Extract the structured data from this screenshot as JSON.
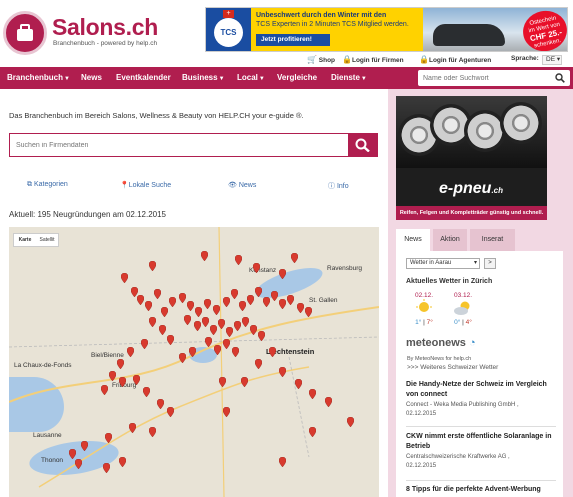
{
  "header": {
    "logo_title": "Salons.ch",
    "logo_subtitle": "Branchenbuch - powered by help.ch",
    "ad": {
      "line1": "Unbeschwert durch den Winter mit den",
      "line2": "TCS Experten in 2 Minuten TCS Mitglied werden.",
      "button": "Jetzt profitieren!",
      "logo": "TCS",
      "badge_l1": "Ostechein",
      "badge_l2": "im Wert von",
      "badge_l3": "CHF 25.-",
      "badge_l4": "schenken."
    },
    "top_links": {
      "shop": "Shop",
      "login_firms": "Login für Firmen",
      "login_agents": "Login für Agenturen",
      "language_label": "Sprache:",
      "language_value": "DE"
    }
  },
  "nav": {
    "items": [
      {
        "label": "Branchenbuch",
        "dropdown": true
      },
      {
        "label": "News",
        "dropdown": false
      },
      {
        "label": "Eventkalender",
        "dropdown": false
      },
      {
        "label": "Business",
        "dropdown": true
      },
      {
        "label": "Local",
        "dropdown": true
      },
      {
        "label": "Vergleiche",
        "dropdown": false
      },
      {
        "label": "Dienste",
        "dropdown": true
      }
    ],
    "search_placeholder": "Name oder Suchwort"
  },
  "main": {
    "intro": "Das Branchenbuch im Bereich Salons, Wellness & Beauty von HELP.CH your e-guide ®.",
    "search_placeholder": "Suchen in Firmendaten",
    "quick_links": [
      "Kategorien",
      "Lokale Suche",
      "News",
      "Info"
    ],
    "news_line": "Aktuell: 195 Neugründungen am 02.12.2015",
    "map": {
      "type_options": [
        "Karte",
        "Satellit"
      ],
      "cities": [
        "Liechtenstein",
        "Biel/Bienne",
        "Fribourg",
        "Lausanne",
        "Thonon",
        "La Chaux-de-Fonds",
        "Ravensburg",
        "St. Gallen",
        "Konstanz"
      ]
    }
  },
  "sidebar": {
    "banner": {
      "logo": "e-pneu",
      "suffix": ".ch",
      "tagline": "Reifen, Felgen und Kompletträder günstig und schnell."
    },
    "tabs": [
      "News",
      "Aktion",
      "Inserat"
    ],
    "weather": {
      "select_value": "Wetter in Aarau",
      "go": ">",
      "title": "Aktuelles Wetter in Zürich",
      "days": [
        {
          "date": "02.12.",
          "min": "1°",
          "max": "7°"
        },
        {
          "date": "03.12.",
          "min": "0°",
          "max": "4°"
        }
      ],
      "provider": "meteonews",
      "by": "By MeteoNews for help.ch",
      "more": ">>> Weiteres Schweizer Wetter"
    },
    "news": [
      {
        "title": "Die Handy-Netze der Schweiz im Vergleich von connect",
        "source": "Connect - Weka Media Publishing GmbH ,",
        "date": "02.12.2015"
      },
      {
        "title": "CKW nimmt erste öffentliche Solaranlage in Betrieb",
        "source": "Centralschweizerische Kraftwerke AG ,",
        "date": "02.12.2015"
      },
      {
        "title": "8 Tipps für die perfekte Advent-Werbung",
        "source": "",
        "date": ""
      }
    ]
  },
  "colors": {
    "brand": "#b01e4f",
    "sidebar_bg": "#f2d8e3",
    "pin": "#d83a2e"
  }
}
